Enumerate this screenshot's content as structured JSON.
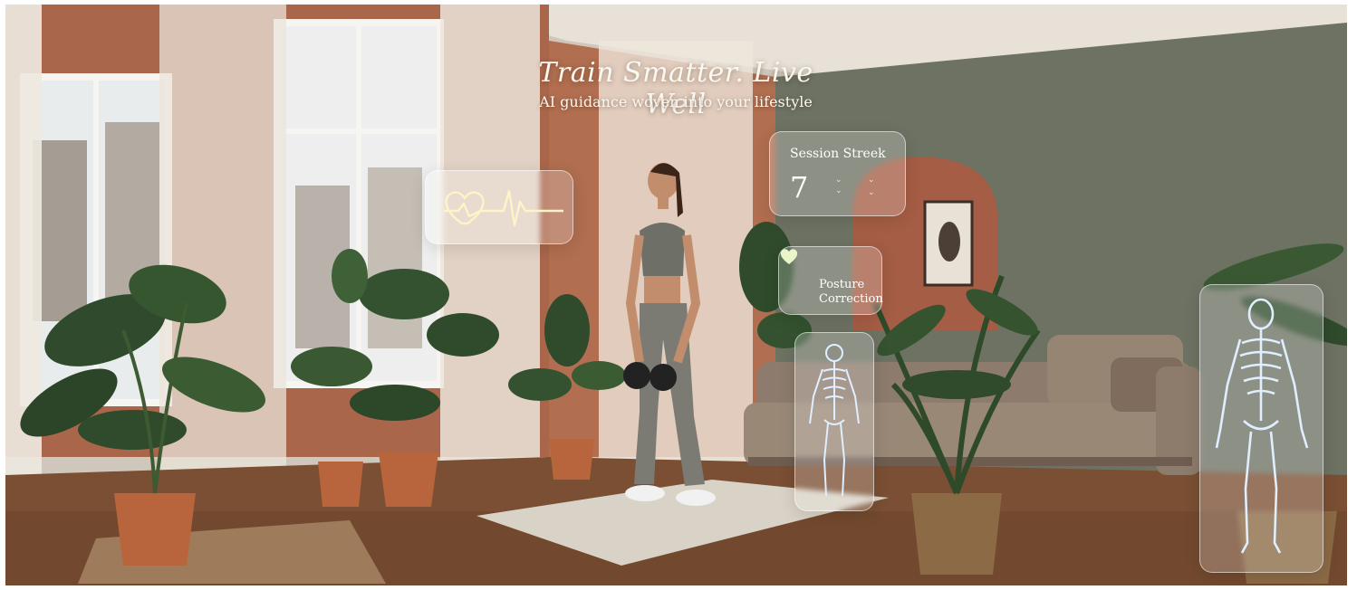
{
  "hero": {
    "title": "Train Smatter. Live Well",
    "subtitle": "AI guidance woven into your lifestyle"
  },
  "cards": {
    "heart_rate": {
      "icon": "heart-pulse-icon"
    },
    "session_streak": {
      "label": "Session Streek",
      "value": "7"
    },
    "posture": {
      "label_line1": "Posture",
      "label_line2": "Correction",
      "icon": "heart-icon"
    },
    "skeleton_small": {
      "icon": "skeleton-icon"
    },
    "skeleton_large": {
      "icon": "skeleton-icon"
    }
  },
  "colors": {
    "wall_left": "#a9664a",
    "wall_right": "#6d7263",
    "floor": "#7a4f33",
    "sofa": "#8d7c6d",
    "glow": "#fff3c8",
    "skeleton": "#dfefff"
  }
}
